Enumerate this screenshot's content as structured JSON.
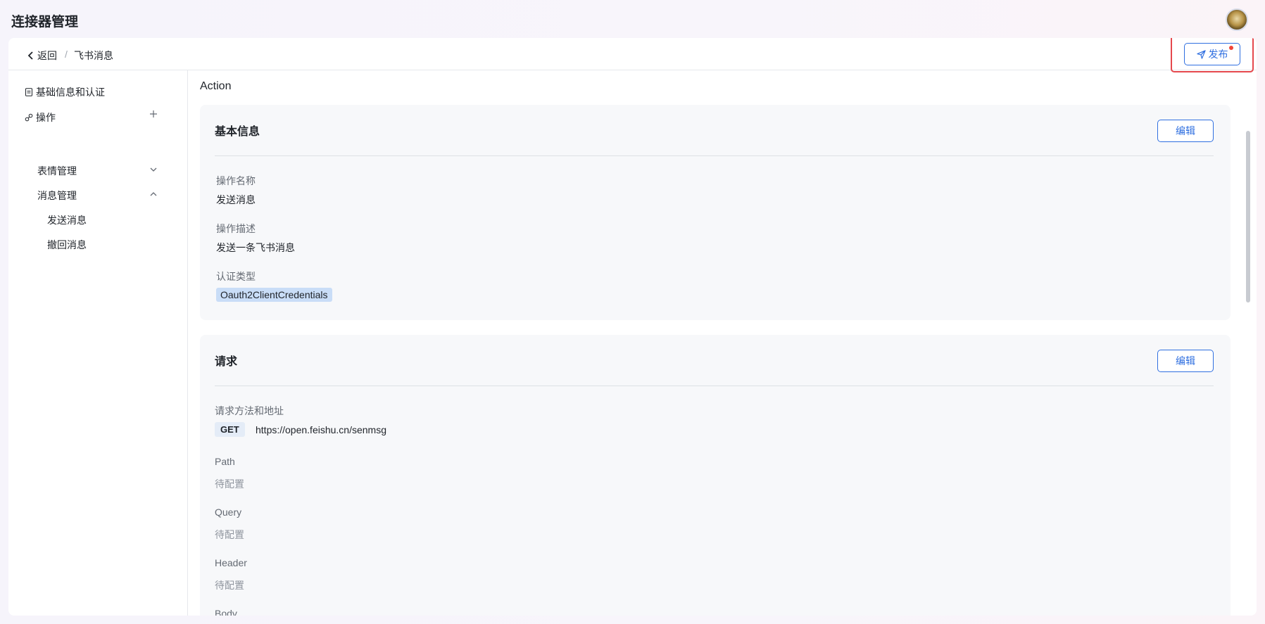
{
  "app": {
    "title": "连接器管理"
  },
  "header": {
    "back_label": "返回",
    "separator": "/",
    "breadcrumb_current": "飞书消息",
    "publish_label": "发布"
  },
  "sidebar": {
    "basic_info": "基础信息和认证",
    "actions": "操作",
    "groups": [
      {
        "label": "表情管理",
        "expanded": false
      },
      {
        "label": "消息管理",
        "expanded": true,
        "items": [
          "发送消息",
          "撤回消息"
        ]
      }
    ]
  },
  "main": {
    "section_title": "Action",
    "basic_card": {
      "title": "基本信息",
      "edit_label": "编辑",
      "name_label": "操作名称",
      "name_value": "发送消息",
      "desc_label": "操作描述",
      "desc_value": "发送一条飞书消息",
      "auth_label": "认证类型",
      "auth_value": "Oauth2ClientCredentials"
    },
    "request_card": {
      "title": "请求",
      "edit_label": "编辑",
      "method_url_label": "请求方法和地址",
      "method": "GET",
      "url": "https://open.feishu.cn/senmsg",
      "path_label": "Path",
      "path_value": "待配置",
      "query_label": "Query",
      "query_value": "待配置",
      "header_label": "Header",
      "header_value": "待配置",
      "body_label": "Body"
    }
  },
  "colors": {
    "accent": "#2f6fe0",
    "highlight_box": "#e5484d",
    "tag_bg": "#c9ddf7"
  },
  "icons": [
    "back-chevron-icon",
    "send-icon",
    "document-icon",
    "link-icon",
    "plus-icon",
    "chevron-down-icon",
    "chevron-up-icon"
  ]
}
